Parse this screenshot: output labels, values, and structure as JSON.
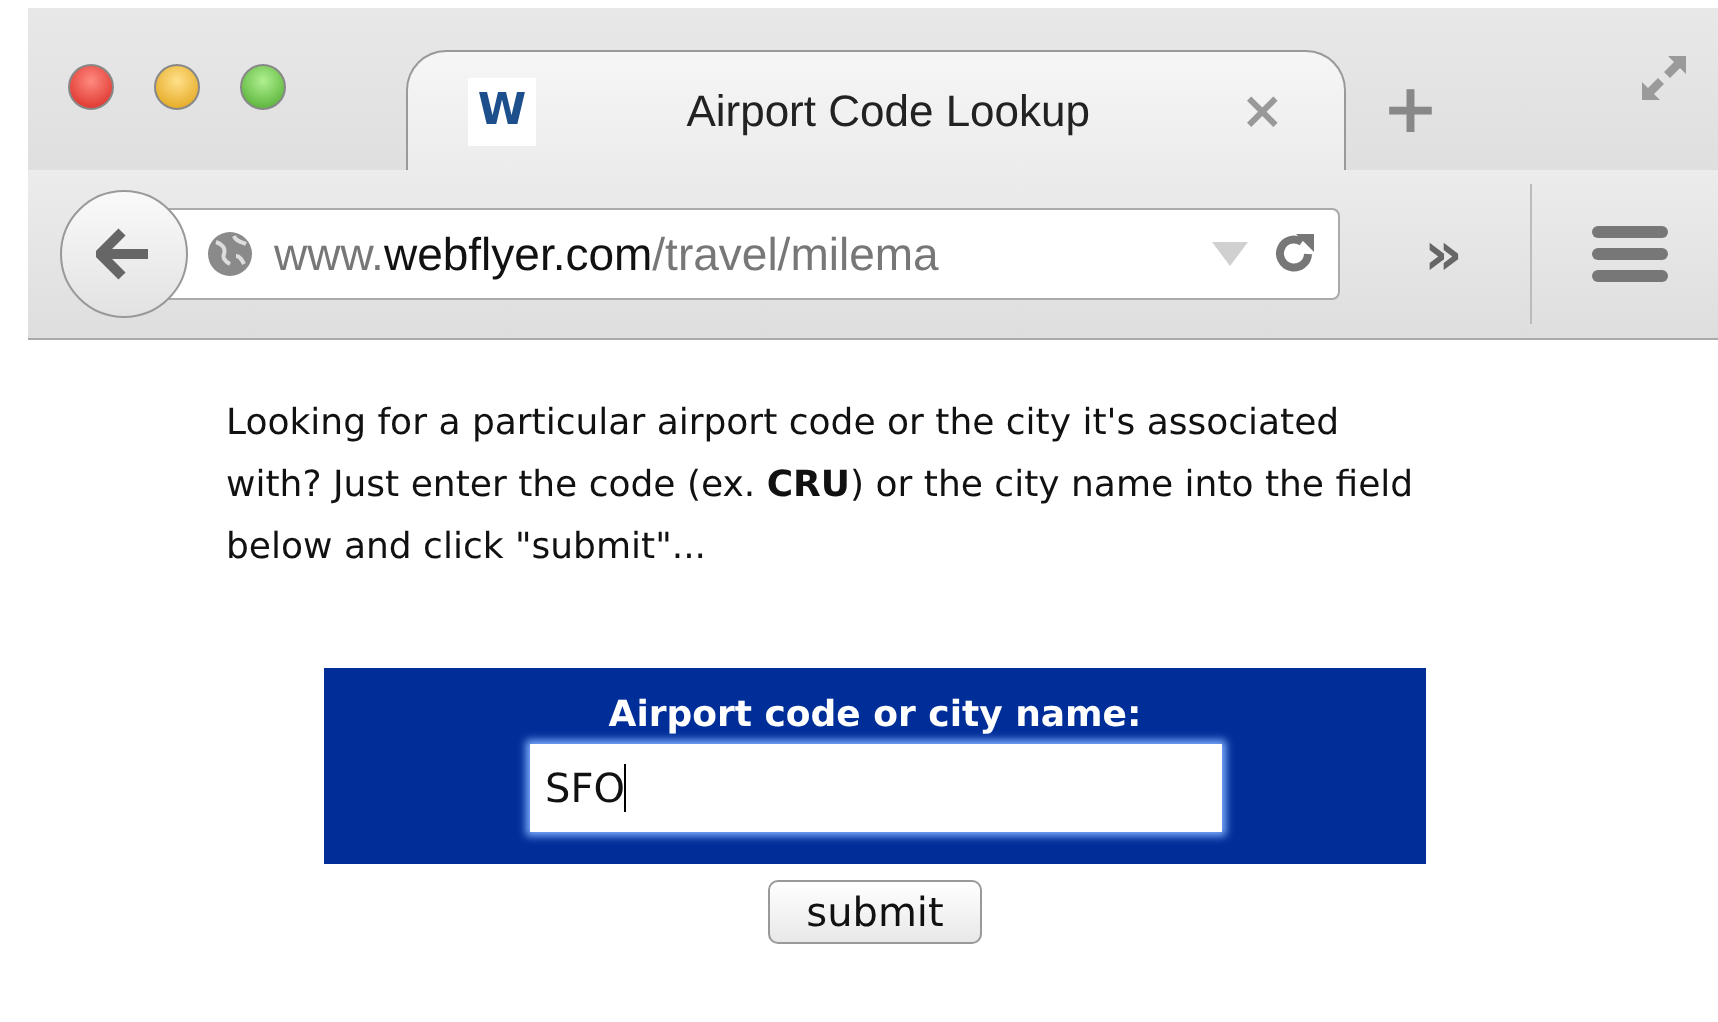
{
  "tab": {
    "title": "Airport Code Lookup",
    "favicon": "W",
    "close": "×",
    "selected": true
  },
  "new_tab": "+",
  "address_bar": {
    "prefix": "www.",
    "domain": "webflyer.com",
    "path": "/travel/milema"
  },
  "overflow": "»",
  "intro": "Looking for a particular airport code or the city it's associated with? Just enter the code (ex. **CRU**) or the city name into the field below and click \"submit\"...",
  "form": {
    "label": "Airport code or city name:",
    "value": "SFO",
    "focused": true,
    "button": "submit"
  }
}
